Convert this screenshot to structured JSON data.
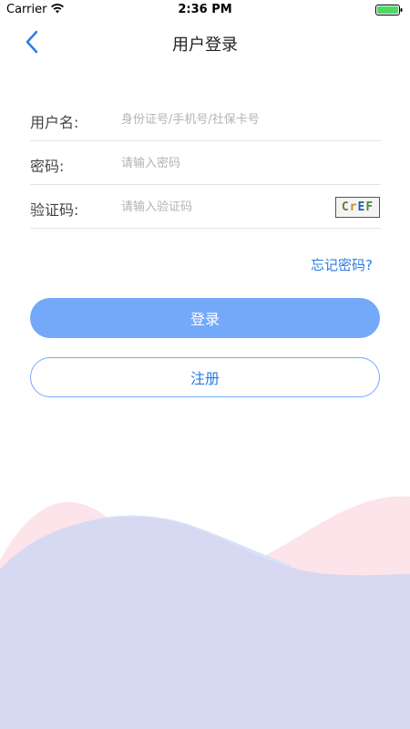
{
  "status_bar": {
    "carrier": "Carrier",
    "time": "2:36 PM",
    "battery_color": "#4cd964"
  },
  "nav": {
    "title": "用户登录"
  },
  "form": {
    "username": {
      "label": "用户名:",
      "placeholder": "身份证号/手机号/社保卡号",
      "value": ""
    },
    "password": {
      "label": "密码:",
      "placeholder": "请输入密码",
      "value": ""
    },
    "captcha": {
      "label": "验证码:",
      "placeholder": "请输入验证码",
      "value": "",
      "image_text": [
        "C",
        "r",
        "E",
        "F"
      ]
    }
  },
  "links": {
    "forgot_password": "忘记密码?"
  },
  "buttons": {
    "login": "登录",
    "register": "注册"
  },
  "colors": {
    "accent": "#2d7be5",
    "button_fill": "#74a9f9",
    "wave_pink": "#fde3ea",
    "wave_lavender": "#d7d8f2",
    "wave_blue": "#d6e3f8"
  }
}
